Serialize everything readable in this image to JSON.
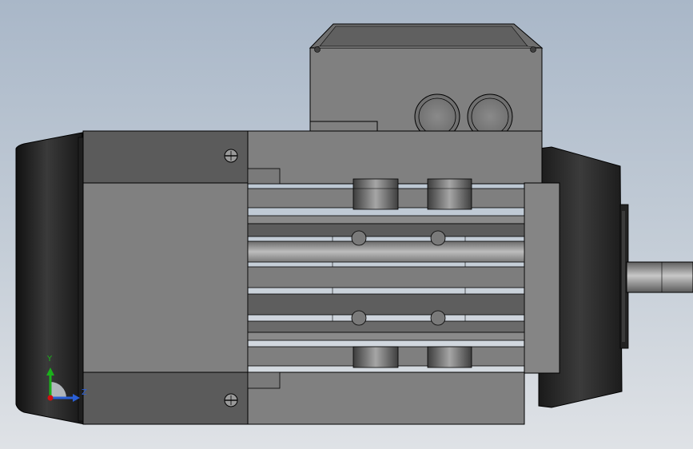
{
  "viewport": {
    "background_top": "#a9b7c8",
    "background_bottom": "#dfe2e6"
  },
  "model": {
    "body_color": "#808080",
    "body_dark_color": "#5a5a5a",
    "cap_color": "#2a2a2a",
    "outline_color": "#000000"
  },
  "triad": {
    "y_label": "Y",
    "z_label": "Z",
    "y_color": "#1bb01b",
    "z_color": "#2a5fd6",
    "origin_color": "#d01010"
  }
}
